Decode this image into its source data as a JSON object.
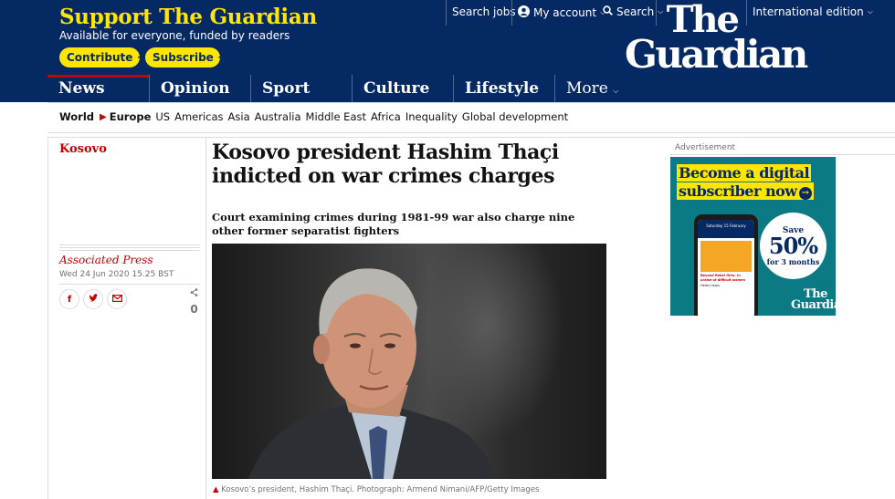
{
  "header": {
    "support_title": "Support The Guardian",
    "support_subtitle": "Available for everyone, funded by readers",
    "contribute_label": "Contribute",
    "subscribe_label": "Subscribe",
    "search_jobs": "Search jobs",
    "my_account": "My account",
    "search": "Search",
    "edition": "International edition",
    "logo_line1": "The",
    "logo_line2": "Guardian"
  },
  "nav": {
    "items": [
      {
        "label": "News"
      },
      {
        "label": "Opinion"
      },
      {
        "label": "Sport"
      },
      {
        "label": "Culture"
      },
      {
        "label": "Lifestyle"
      },
      {
        "label": "More"
      }
    ]
  },
  "subnav": {
    "world": "World",
    "europe": "Europe",
    "items": [
      "US",
      "Americas",
      "Asia",
      "Australia",
      "Middle East",
      "Africa",
      "Inequality",
      "Global development"
    ]
  },
  "article": {
    "section": "Kosovo",
    "headline": "Kosovo president Hashim Thaçi indicted on war crimes charges",
    "standfirst": "Court examining crimes during 1981-99 war also charge nine other former separatist fighters",
    "byline": "Associated Press",
    "date": "Wed 24 Jun 2020 15.25 BST",
    "share_count": "0",
    "caption": "Kosovo’s president, Hashim Thaçi. Photograph: Armend Nimani/AFP/Getty Images"
  },
  "ad": {
    "label": "Advertisement",
    "line1": "Become a digital",
    "line2": "subscriber now",
    "save": "Save",
    "percent": "50%",
    "duration": "for 3 months",
    "logo1": "The",
    "logo2": "Guardian",
    "phone_date": "Saturday 15 February",
    "phone_text": "Beyond Rebel Girls: in praise of difficult women",
    "phone_author": "Helen Lewis"
  },
  "colors": {
    "brand_blue": "#052962",
    "brand_yellow": "#ffe500",
    "news_red": "#c70000",
    "ad_teal": "#0b7a85"
  },
  "icons": {
    "account": "user-icon",
    "search": "search-icon",
    "share": "share-icon",
    "facebook": "facebook-icon",
    "twitter": "twitter-icon",
    "email": "email-icon"
  }
}
